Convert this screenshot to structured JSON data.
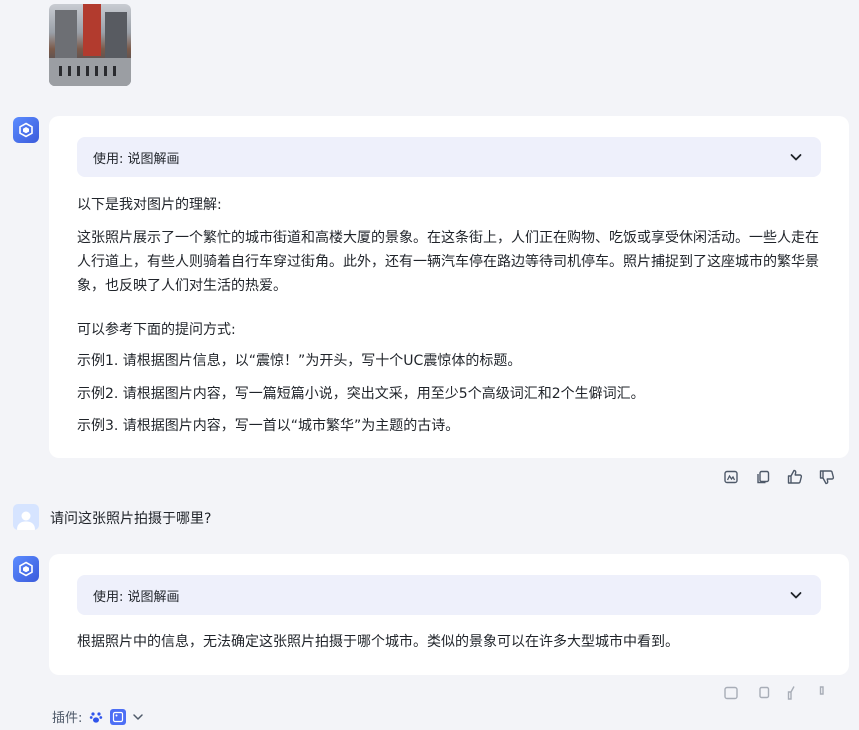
{
  "conversation": {
    "answer1": {
      "plugin_label": "使用: 说图解画",
      "intro": "以下是我对图片的理解:",
      "description": "这张照片展示了一个繁忙的城市街道和高楼大厦的景象。在这条街上，人们正在购物、吃饭或享受休闲活动。一些人走在人行道上，有些人则骑着自行车穿过街角。此外，还有一辆汽车停在路边等待司机停车。照片捕捉到了这座城市的繁华景象，也反映了人们对生活的热爱。",
      "suggest_title": "可以参考下面的提问方式:",
      "examples": [
        "示例1. 请根据图片信息，以“震惊！”为开头，写十个UC震惊体的标题。",
        "示例2. 请根据图片内容，写一篇短篇小说，突出文采，用至少5个高级词汇和2个生僻词汇。",
        "示例3. 请根据图片内容，写一首以“城市繁华”为主题的古诗。"
      ]
    },
    "question": "请问这张照片拍摄于哪里?",
    "answer2": {
      "plugin_label": "使用: 说图解画",
      "text": "根据照片中的信息，无法确定这张照片拍摄于哪个城市。类似的景象可以在许多大型城市中看到。"
    }
  },
  "footer": {
    "plugins_label": "插件:"
  },
  "icons": {
    "bot_avatar": "cube-logo-icon",
    "user_avatar": "user-silhouette-icon",
    "actions": [
      "image-icon",
      "copy-icon",
      "thumbs-up-icon",
      "thumbs-down-icon"
    ]
  },
  "colors": {
    "background": "#f3f4f8",
    "card": "#ffffff",
    "plugin_bar": "#eef0fb",
    "accent": "#3b5bdb"
  }
}
